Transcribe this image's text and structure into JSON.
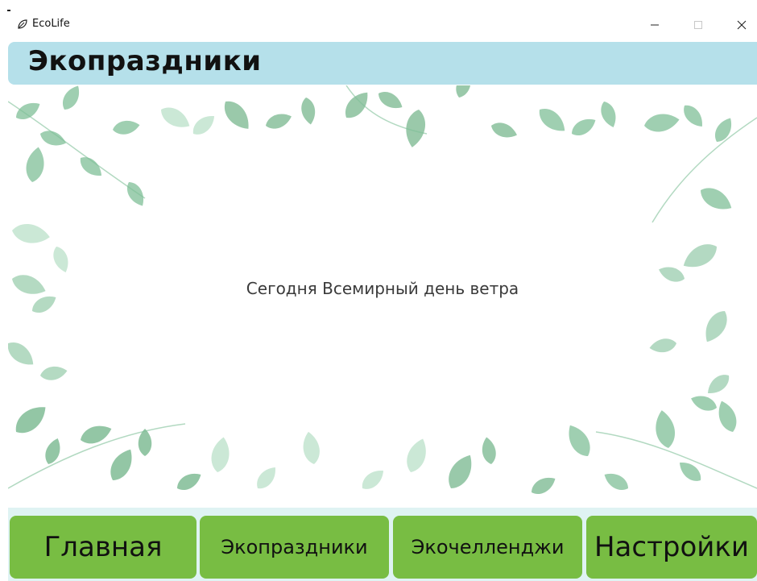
{
  "window": {
    "title": "EcoLife",
    "app_icon": "leaf-icon",
    "controls": {
      "minimize_icon": "minimize-icon",
      "maximize_icon": "maximize-icon",
      "close_icon": "close-icon"
    }
  },
  "header": {
    "title": "Экопраздники",
    "background": "#b5e0ea"
  },
  "main": {
    "message": "Сегодня Всемирный день ветра",
    "decoration": "watercolor-leaves-frame"
  },
  "nav": {
    "items": [
      {
        "label": "Главная"
      },
      {
        "label": "Экопраздники"
      },
      {
        "label": "Экочелленджи"
      },
      {
        "label": "Настройки"
      }
    ],
    "button_color": "#78bd43",
    "bar_color": "#dff3f3"
  }
}
